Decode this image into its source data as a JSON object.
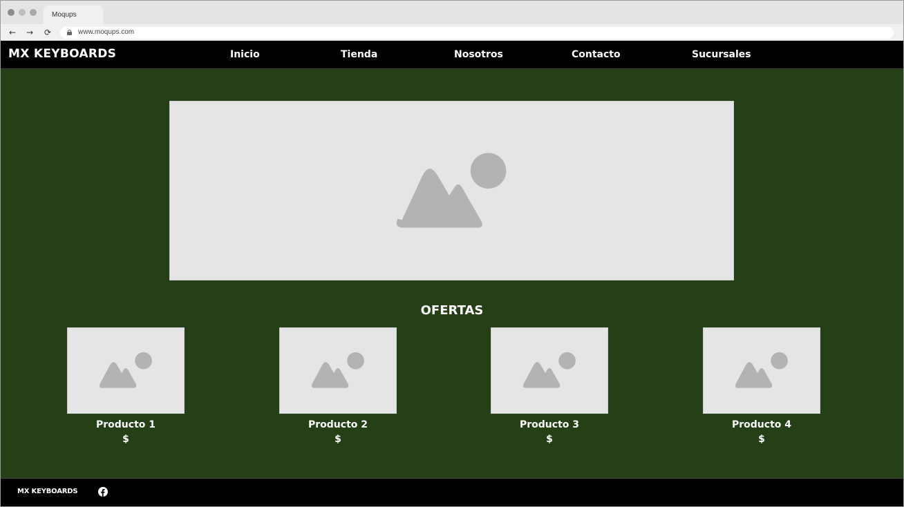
{
  "browser": {
    "tab_title": "Moqups",
    "url": "www.moqups.com",
    "back_glyph": "←",
    "forward_glyph": "→",
    "reload_glyph": "⟳"
  },
  "header": {
    "brand": "MX KEYBOARDS",
    "menu": [
      {
        "label": "Inicio"
      },
      {
        "label": "Tienda"
      },
      {
        "label": "Nosotros"
      },
      {
        "label": "Contacto"
      },
      {
        "label": "Sucursales"
      }
    ]
  },
  "offers": {
    "title": "OFERTAS",
    "products": [
      {
        "name": "Producto 1",
        "price": "$"
      },
      {
        "name": "Producto 2",
        "price": "$"
      },
      {
        "name": "Producto 3",
        "price": "$"
      },
      {
        "name": "Producto 4",
        "price": "$"
      }
    ]
  },
  "footer": {
    "brand": "MX KEYBOARDS",
    "social_icon": "facebook-icon"
  },
  "colors": {
    "main_bg": "#253f17",
    "header_bg": "#000000",
    "placeholder_bg": "#e5e5e5",
    "placeholder_icon": "#b3b3b3"
  }
}
